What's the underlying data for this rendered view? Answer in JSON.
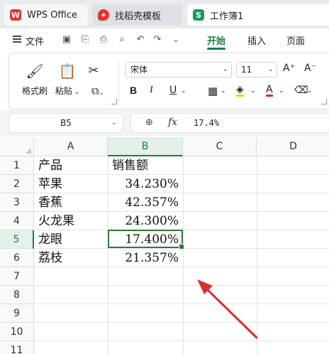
{
  "tabs": [
    {
      "label": "WPS Office",
      "icon": "wps-logo-icon"
    },
    {
      "label": "找稻壳模板",
      "icon": "docer-logo-icon"
    },
    {
      "label": "工作簿1",
      "icon": "sheet-s-icon",
      "icon_text": "S"
    }
  ],
  "menu": {
    "file_label": "文件",
    "tabs": [
      "开始",
      "插入",
      "页面"
    ],
    "active_tab": "开始"
  },
  "ribbon": {
    "format_painter": "格式刷",
    "paste": "粘贴",
    "font_name": "宋体",
    "font_size": "11",
    "bold": "B",
    "italic": "I",
    "underline": "U",
    "font_color_letter": "A",
    "grow_font": "A⁺",
    "shrink_font": "A⁻"
  },
  "formula_bar": {
    "name_box": "B5",
    "fx_label": "fx",
    "formula_value": "17.4%"
  },
  "grid": {
    "columns": [
      "A",
      "B",
      "C",
      "D"
    ],
    "selected_column": "B",
    "rows": [
      "1",
      "2",
      "3",
      "4",
      "5",
      "6",
      "7",
      "8",
      "9",
      "10",
      "11"
    ],
    "selected_row": "5",
    "cells": [
      {
        "a": "产品",
        "b": "销售额"
      },
      {
        "a": "苹果",
        "b": "34.230%"
      },
      {
        "a": "香蕉",
        "b": "42.357%"
      },
      {
        "a": "火龙果",
        "b": "24.300%"
      },
      {
        "a": "龙眼",
        "b": "17.400%"
      },
      {
        "a": "荔枝",
        "b": "21.357%"
      }
    ]
  },
  "colors": {
    "accent": "#1a7d4a",
    "active_cell_border": "#2e7d32",
    "annotation_arrow": "#d9302c"
  }
}
